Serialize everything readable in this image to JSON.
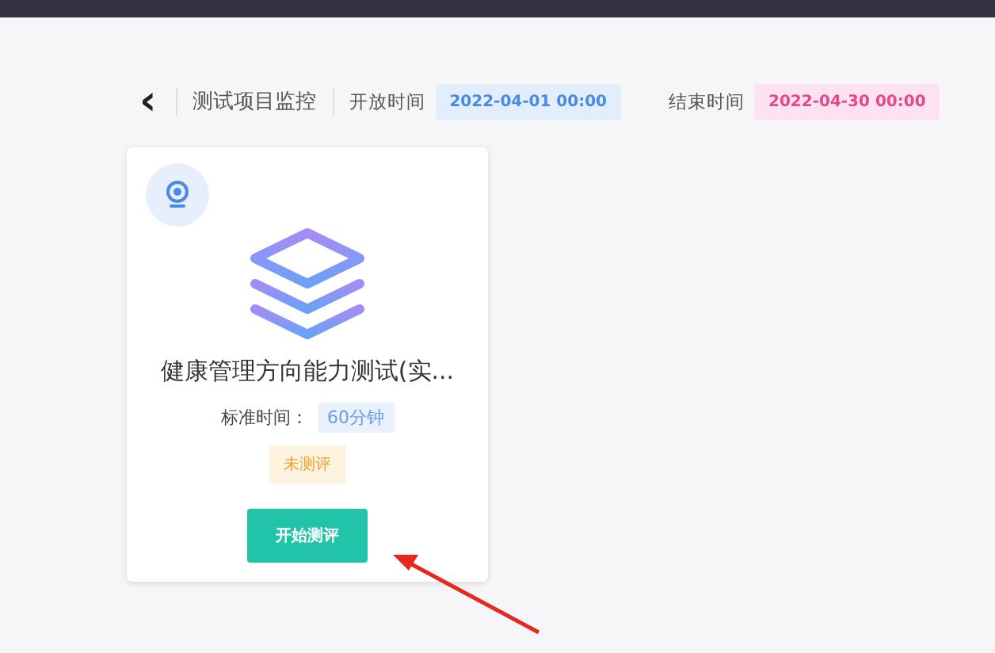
{
  "header": {
    "back_icon": "‹",
    "title": "测试项目监控",
    "open_label": "开放时间",
    "open_time": "2022-04-01 00:00",
    "end_label": "结束时间",
    "end_time": "2022-04-30 00:00"
  },
  "cards": [
    {
      "title": "健康管理方向能力测试(实...",
      "duration_label": "标准时间：",
      "duration": "60分钟",
      "status": "未测评",
      "button": "开始测评"
    }
  ]
}
